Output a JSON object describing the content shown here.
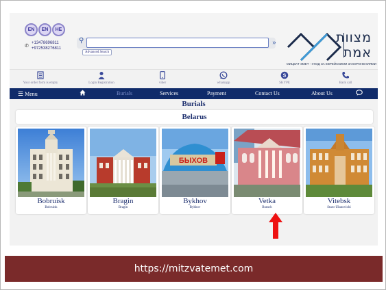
{
  "header": {
    "languages": [
      "EN",
      "EN",
      "HE"
    ],
    "phones": [
      "+13478696811",
      "+972538276811"
    ],
    "search": {
      "placeholder": "",
      "advanced_label": "Advanced Search"
    },
    "logo": {
      "line1": "מצוות",
      "line2": "אמת",
      "tagline": "МИЦВАТ ЭМЕТ - УХОД ЗА ЕВРЕЙСКИМИ ЗАХОРОНЕНИЯМИ"
    }
  },
  "contact_strip": [
    {
      "icon": "clipboard-icon",
      "label": "Your order form is empty"
    },
    {
      "icon": "user-icon",
      "label": "Login Registration"
    },
    {
      "icon": "phone-icon",
      "label": "viber"
    },
    {
      "icon": "whatsapp-icon",
      "label": "whatsapp"
    },
    {
      "icon": "skype-icon",
      "label": "SKYPE"
    },
    {
      "icon": "handset-icon",
      "label": "Back call"
    }
  ],
  "nav": {
    "menu_label": "Menu",
    "items": [
      "Burials",
      "Services",
      "Payment",
      "Contact Us",
      "About Us"
    ],
    "active": "Burials"
  },
  "content": {
    "section_title": "Burials",
    "country": "Belarus",
    "cards": [
      {
        "name": "Bobruisk",
        "sub": "Bobruisk"
      },
      {
        "name": "Bragin",
        "sub": "Bragin"
      },
      {
        "name": "Bykhov",
        "sub": "Bykhov"
      },
      {
        "name": "Vetka",
        "sub": "Branch"
      },
      {
        "name": "Vitebsk",
        "sub": "Staro-Ulanovichi"
      }
    ],
    "photo_sign_text": "БЫХОВ"
  },
  "annotation": {
    "url": "https://mitzvatemet.com",
    "arrow_color": "#ee1111",
    "band_color": "#7a2a2a"
  }
}
